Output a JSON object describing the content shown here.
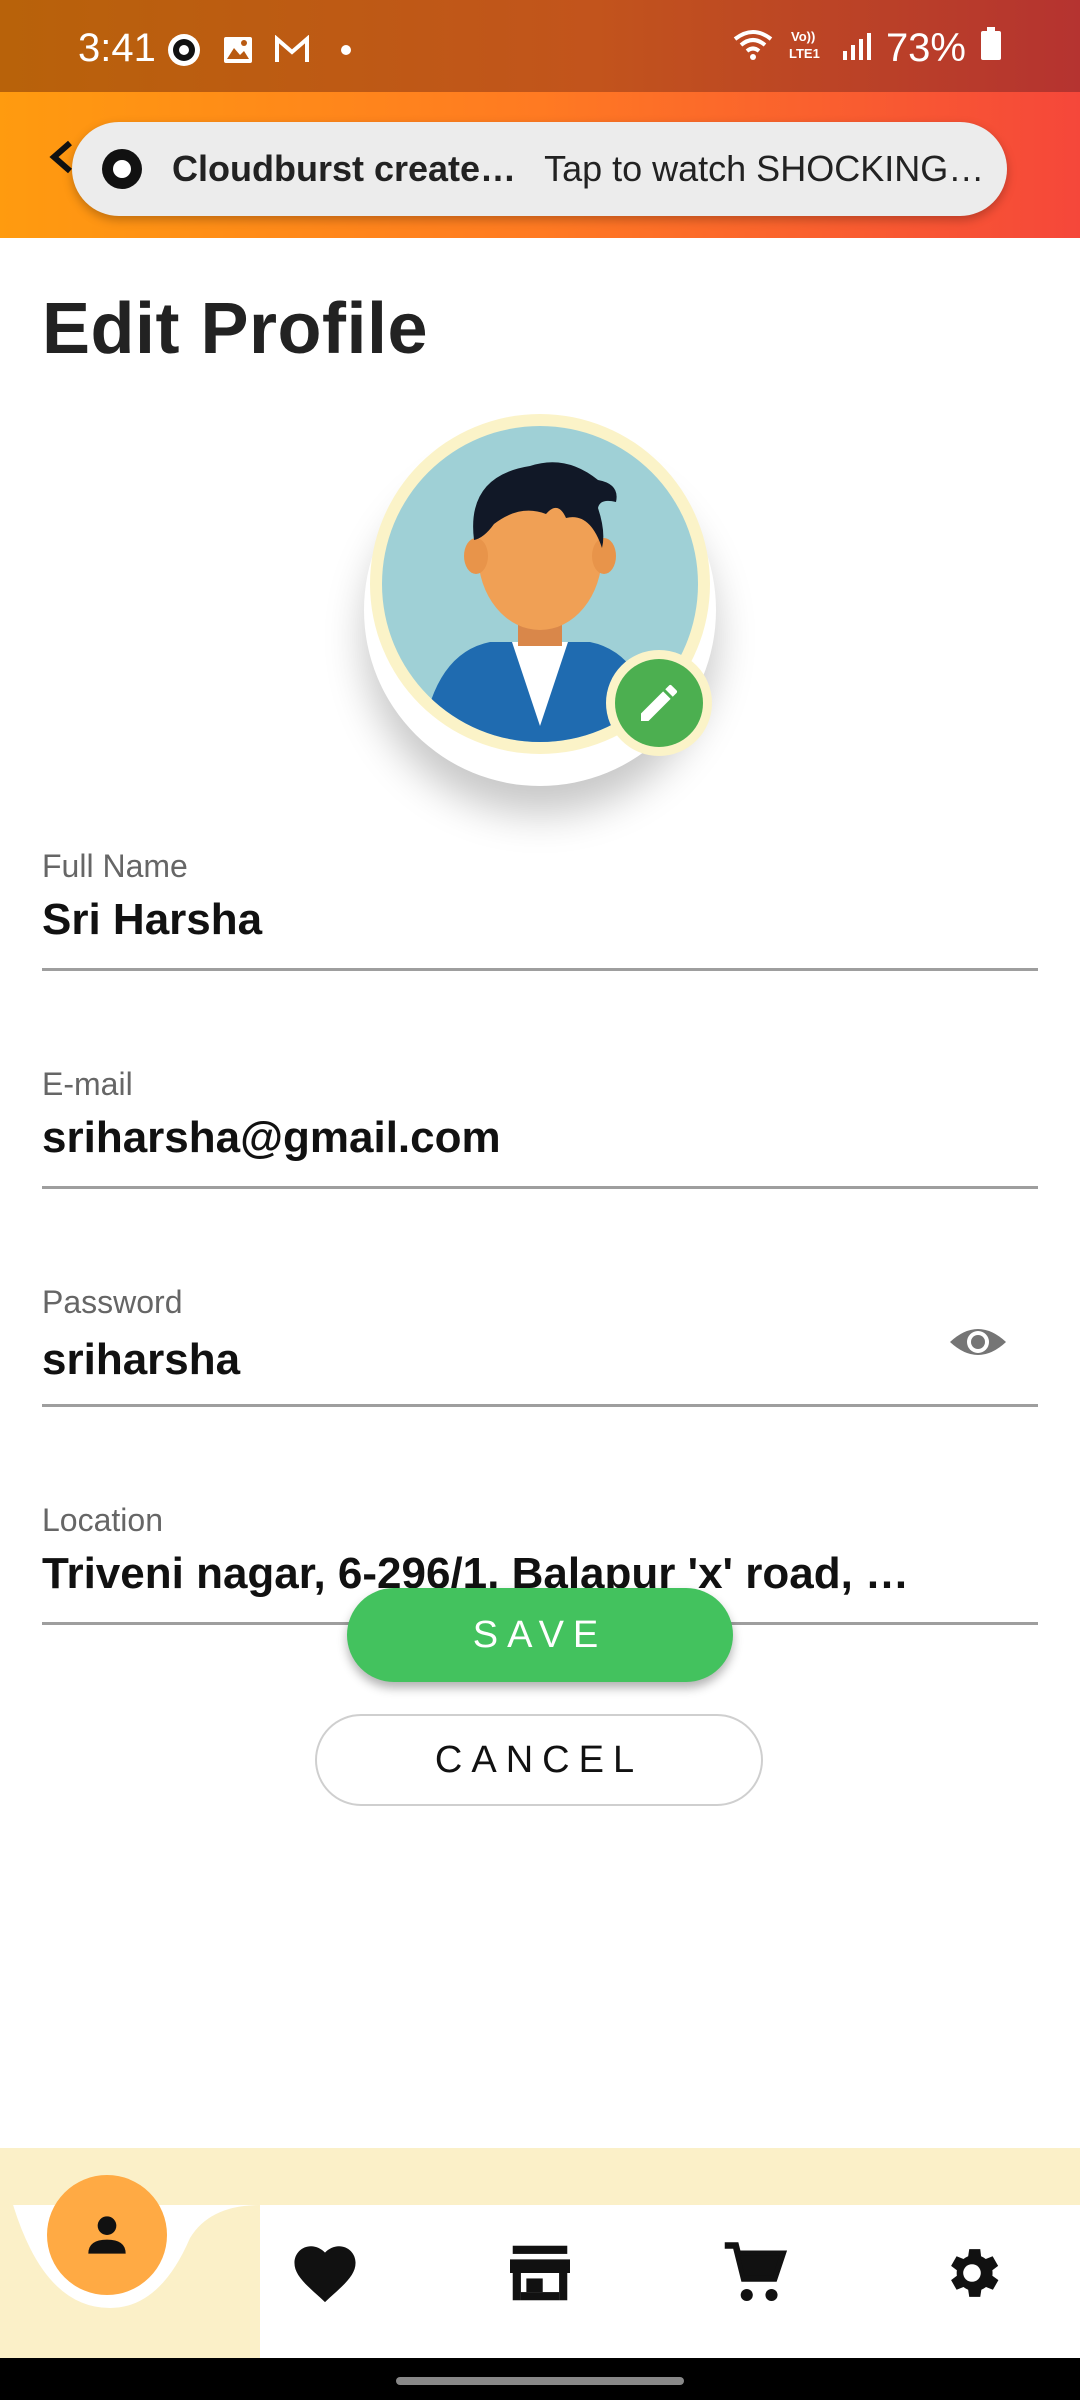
{
  "status_bar": {
    "time": "3:41",
    "battery": "73%",
    "icons_left": [
      "zee5-icon",
      "gallery-icon",
      "gmail-icon",
      "dot-icon"
    ],
    "icons_right": [
      "wifi-calling-icon",
      "volte-icon",
      "signal-icon",
      "battery-icon"
    ]
  },
  "notification": {
    "title": "Cloudburst create…",
    "text": "Tap to watch SHOCKING…"
  },
  "page": {
    "title": "Edit Profile"
  },
  "form": {
    "full_name": {
      "label": "Full Name",
      "value": "Sri Harsha"
    },
    "email": {
      "label": "E-mail",
      "value": "sriharsha@gmail.com"
    },
    "password": {
      "label": "Password",
      "value": "sriharsha"
    },
    "location": {
      "label": "Location",
      "value": "Triveni nagar, 6-296/1, Balapur 'x' road, …"
    }
  },
  "buttons": {
    "save": "SAVE",
    "cancel": "CANCEL"
  },
  "bottom_nav": {
    "items": [
      "profile-icon",
      "heart-icon",
      "store-icon",
      "cart-icon",
      "settings-icon"
    ],
    "active": "profile-icon"
  },
  "colors": {
    "accent_orange": "#ffaa44",
    "save_green": "#43c25e",
    "edit_badge_green": "#4caf50",
    "cream": "#fbf0c8"
  }
}
